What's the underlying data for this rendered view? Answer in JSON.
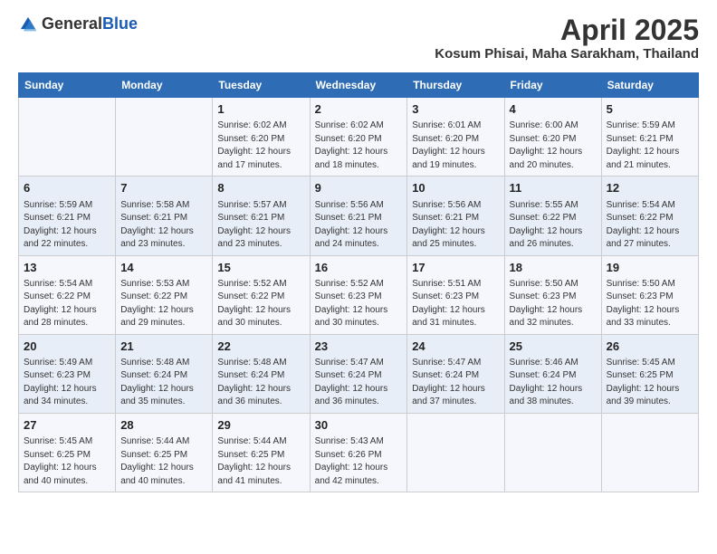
{
  "header": {
    "logo_general": "General",
    "logo_blue": "Blue",
    "month_title": "April 2025",
    "location": "Kosum Phisai, Maha Sarakham, Thailand"
  },
  "weekdays": [
    "Sunday",
    "Monday",
    "Tuesday",
    "Wednesday",
    "Thursday",
    "Friday",
    "Saturday"
  ],
  "weeks": [
    [
      {
        "day": "",
        "sunrise": "",
        "sunset": "",
        "daylight": ""
      },
      {
        "day": "",
        "sunrise": "",
        "sunset": "",
        "daylight": ""
      },
      {
        "day": "1",
        "sunrise": "Sunrise: 6:02 AM",
        "sunset": "Sunset: 6:20 PM",
        "daylight": "Daylight: 12 hours and 17 minutes."
      },
      {
        "day": "2",
        "sunrise": "Sunrise: 6:02 AM",
        "sunset": "Sunset: 6:20 PM",
        "daylight": "Daylight: 12 hours and 18 minutes."
      },
      {
        "day": "3",
        "sunrise": "Sunrise: 6:01 AM",
        "sunset": "Sunset: 6:20 PM",
        "daylight": "Daylight: 12 hours and 19 minutes."
      },
      {
        "day": "4",
        "sunrise": "Sunrise: 6:00 AM",
        "sunset": "Sunset: 6:20 PM",
        "daylight": "Daylight: 12 hours and 20 minutes."
      },
      {
        "day": "5",
        "sunrise": "Sunrise: 5:59 AM",
        "sunset": "Sunset: 6:21 PM",
        "daylight": "Daylight: 12 hours and 21 minutes."
      }
    ],
    [
      {
        "day": "6",
        "sunrise": "Sunrise: 5:59 AM",
        "sunset": "Sunset: 6:21 PM",
        "daylight": "Daylight: 12 hours and 22 minutes."
      },
      {
        "day": "7",
        "sunrise": "Sunrise: 5:58 AM",
        "sunset": "Sunset: 6:21 PM",
        "daylight": "Daylight: 12 hours and 23 minutes."
      },
      {
        "day": "8",
        "sunrise": "Sunrise: 5:57 AM",
        "sunset": "Sunset: 6:21 PM",
        "daylight": "Daylight: 12 hours and 23 minutes."
      },
      {
        "day": "9",
        "sunrise": "Sunrise: 5:56 AM",
        "sunset": "Sunset: 6:21 PM",
        "daylight": "Daylight: 12 hours and 24 minutes."
      },
      {
        "day": "10",
        "sunrise": "Sunrise: 5:56 AM",
        "sunset": "Sunset: 6:21 PM",
        "daylight": "Daylight: 12 hours and 25 minutes."
      },
      {
        "day": "11",
        "sunrise": "Sunrise: 5:55 AM",
        "sunset": "Sunset: 6:22 PM",
        "daylight": "Daylight: 12 hours and 26 minutes."
      },
      {
        "day": "12",
        "sunrise": "Sunrise: 5:54 AM",
        "sunset": "Sunset: 6:22 PM",
        "daylight": "Daylight: 12 hours and 27 minutes."
      }
    ],
    [
      {
        "day": "13",
        "sunrise": "Sunrise: 5:54 AM",
        "sunset": "Sunset: 6:22 PM",
        "daylight": "Daylight: 12 hours and 28 minutes."
      },
      {
        "day": "14",
        "sunrise": "Sunrise: 5:53 AM",
        "sunset": "Sunset: 6:22 PM",
        "daylight": "Daylight: 12 hours and 29 minutes."
      },
      {
        "day": "15",
        "sunrise": "Sunrise: 5:52 AM",
        "sunset": "Sunset: 6:22 PM",
        "daylight": "Daylight: 12 hours and 30 minutes."
      },
      {
        "day": "16",
        "sunrise": "Sunrise: 5:52 AM",
        "sunset": "Sunset: 6:23 PM",
        "daylight": "Daylight: 12 hours and 30 minutes."
      },
      {
        "day": "17",
        "sunrise": "Sunrise: 5:51 AM",
        "sunset": "Sunset: 6:23 PM",
        "daylight": "Daylight: 12 hours and 31 minutes."
      },
      {
        "day": "18",
        "sunrise": "Sunrise: 5:50 AM",
        "sunset": "Sunset: 6:23 PM",
        "daylight": "Daylight: 12 hours and 32 minutes."
      },
      {
        "day": "19",
        "sunrise": "Sunrise: 5:50 AM",
        "sunset": "Sunset: 6:23 PM",
        "daylight": "Daylight: 12 hours and 33 minutes."
      }
    ],
    [
      {
        "day": "20",
        "sunrise": "Sunrise: 5:49 AM",
        "sunset": "Sunset: 6:23 PM",
        "daylight": "Daylight: 12 hours and 34 minutes."
      },
      {
        "day": "21",
        "sunrise": "Sunrise: 5:48 AM",
        "sunset": "Sunset: 6:24 PM",
        "daylight": "Daylight: 12 hours and 35 minutes."
      },
      {
        "day": "22",
        "sunrise": "Sunrise: 5:48 AM",
        "sunset": "Sunset: 6:24 PM",
        "daylight": "Daylight: 12 hours and 36 minutes."
      },
      {
        "day": "23",
        "sunrise": "Sunrise: 5:47 AM",
        "sunset": "Sunset: 6:24 PM",
        "daylight": "Daylight: 12 hours and 36 minutes."
      },
      {
        "day": "24",
        "sunrise": "Sunrise: 5:47 AM",
        "sunset": "Sunset: 6:24 PM",
        "daylight": "Daylight: 12 hours and 37 minutes."
      },
      {
        "day": "25",
        "sunrise": "Sunrise: 5:46 AM",
        "sunset": "Sunset: 6:24 PM",
        "daylight": "Daylight: 12 hours and 38 minutes."
      },
      {
        "day": "26",
        "sunrise": "Sunrise: 5:45 AM",
        "sunset": "Sunset: 6:25 PM",
        "daylight": "Daylight: 12 hours and 39 minutes."
      }
    ],
    [
      {
        "day": "27",
        "sunrise": "Sunrise: 5:45 AM",
        "sunset": "Sunset: 6:25 PM",
        "daylight": "Daylight: 12 hours and 40 minutes."
      },
      {
        "day": "28",
        "sunrise": "Sunrise: 5:44 AM",
        "sunset": "Sunset: 6:25 PM",
        "daylight": "Daylight: 12 hours and 40 minutes."
      },
      {
        "day": "29",
        "sunrise": "Sunrise: 5:44 AM",
        "sunset": "Sunset: 6:25 PM",
        "daylight": "Daylight: 12 hours and 41 minutes."
      },
      {
        "day": "30",
        "sunrise": "Sunrise: 5:43 AM",
        "sunset": "Sunset: 6:26 PM",
        "daylight": "Daylight: 12 hours and 42 minutes."
      },
      {
        "day": "",
        "sunrise": "",
        "sunset": "",
        "daylight": ""
      },
      {
        "day": "",
        "sunrise": "",
        "sunset": "",
        "daylight": ""
      },
      {
        "day": "",
        "sunrise": "",
        "sunset": "",
        "daylight": ""
      }
    ]
  ]
}
